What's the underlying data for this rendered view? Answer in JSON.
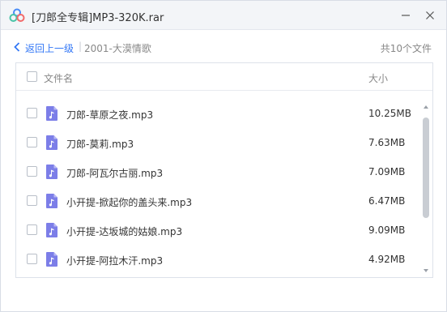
{
  "window": {
    "title": "[刀郎全专辑]MP3-320K.rar",
    "icon": "baidu-netdisk-cloud-icon",
    "controls": [
      "minimize-icon",
      "close-icon"
    ]
  },
  "toolbar": {
    "back_label": "返回上一级",
    "separator": "|",
    "breadcrumb": "2001-大漠情歌",
    "file_count": "共10个文件"
  },
  "list": {
    "header": {
      "name": "文件名",
      "size": "大小"
    },
    "files": [
      {
        "name": "刀郎-草原之夜.mp3",
        "size": "10.25MB"
      },
      {
        "name": "刀郎-莫莉.mp3",
        "size": "7.63MB"
      },
      {
        "name": "刀郎-阿瓦尔古丽.mp3",
        "size": "7.09MB"
      },
      {
        "name": "小开提-掀起你的盖头来.mp3",
        "size": "6.47MB"
      },
      {
        "name": "小开提-达坂城的姑娘.mp3",
        "size": "9.09MB"
      },
      {
        "name": "小开提-阿拉木汗.mp3",
        "size": "4.92MB"
      }
    ],
    "file_icon": "audio-file-icon",
    "scroll_position": 0
  },
  "colors": {
    "accent": "#3478f6",
    "file_icon": "#7c7ee8",
    "titlebar": "#f3f5f8"
  }
}
